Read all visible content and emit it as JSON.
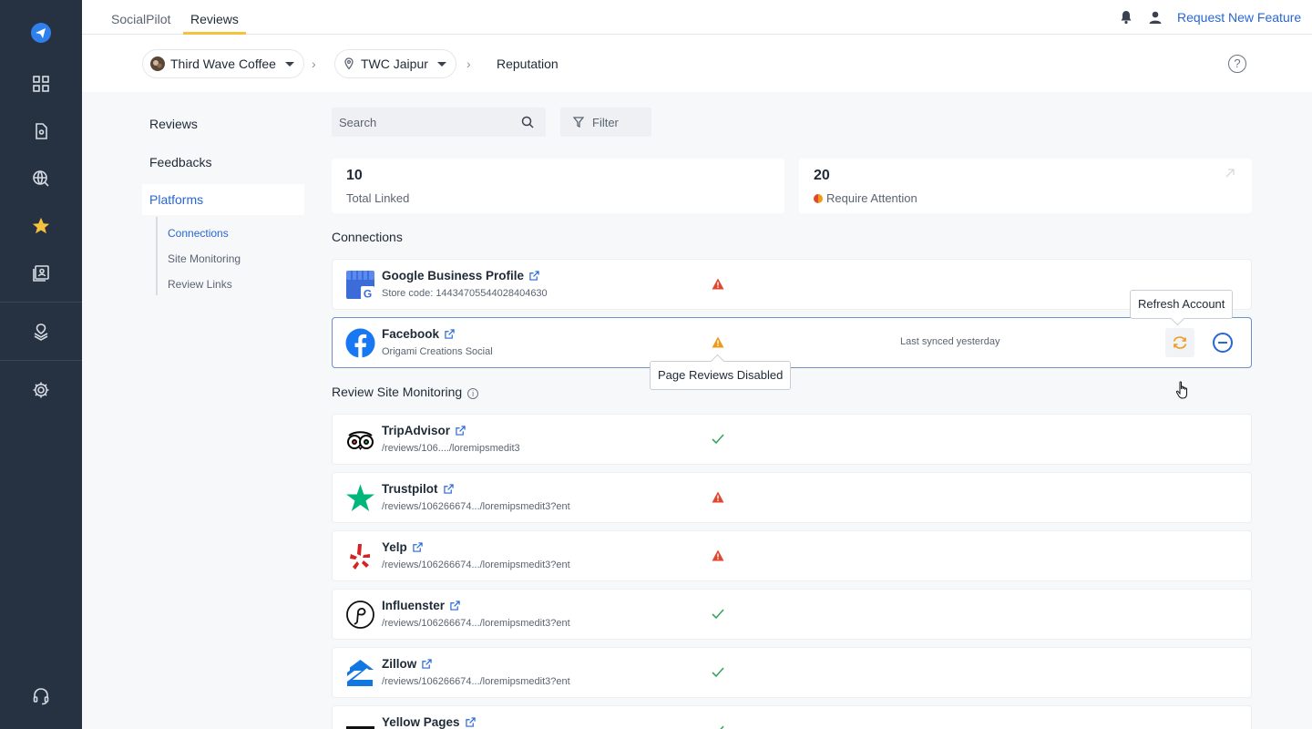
{
  "topbar": {
    "tabs": [
      {
        "label": "SocialPilot"
      },
      {
        "label": "Reviews"
      }
    ],
    "request_feature": "Request New Feature"
  },
  "breadcrumb": {
    "brand": "Third Wave Coffee",
    "location": "TWC Jaipur",
    "current": "Reputation"
  },
  "subnav": {
    "items": [
      {
        "label": "Reviews"
      },
      {
        "label": "Feedbacks"
      },
      {
        "label": "Platforms"
      }
    ],
    "children": [
      {
        "label": "Connections"
      },
      {
        "label": "Site Monitoring"
      },
      {
        "label": "Review Links"
      }
    ]
  },
  "toolbar": {
    "search_placeholder": "Search",
    "filter_label": "Filter"
  },
  "stats": [
    {
      "value": "10",
      "label": "Total Linked"
    },
    {
      "value": "20",
      "label": "Require Attention"
    }
  ],
  "connections": {
    "title": "Connections",
    "rows": [
      {
        "name": "Google Business Profile",
        "sub": "Store code: 14434705544028404630",
        "status": "warning-red"
      },
      {
        "name": "Facebook",
        "sub": "Origami Creations Social",
        "status": "warning-orange",
        "sync": "Last synced yesterday"
      }
    ]
  },
  "tooltips": {
    "refresh": "Refresh Account",
    "page_reviews": "Page Reviews Disabled"
  },
  "monitoring": {
    "title": "Review Site Monitoring",
    "rows": [
      {
        "name": "TripAdvisor",
        "sub": "/reviews/106..../loremipsmedit3",
        "status": "ok"
      },
      {
        "name": "Trustpilot",
        "sub": "/reviews/106266674.../loremipsmedit3?ent",
        "status": "warning-red"
      },
      {
        "name": "Yelp",
        "sub": "/reviews/106266674.../loremipsmedit3?ent",
        "status": "warning-red"
      },
      {
        "name": "Influenster",
        "sub": "/reviews/106266674.../loremipsmedit3?ent",
        "status": "ok"
      },
      {
        "name": "Zillow",
        "sub": "/reviews/106266674.../loremipsmedit3?ent",
        "status": "ok"
      },
      {
        "name": "Yellow Pages",
        "sub": "",
        "status": "ok"
      }
    ]
  },
  "colors": {
    "rail": "#263142",
    "accent": "#2866d6",
    "tab_underline": "#f6c23e",
    "warning_red": "#e2462f",
    "warning_orange": "#f09a1a",
    "ok_green": "#3aa55d"
  }
}
